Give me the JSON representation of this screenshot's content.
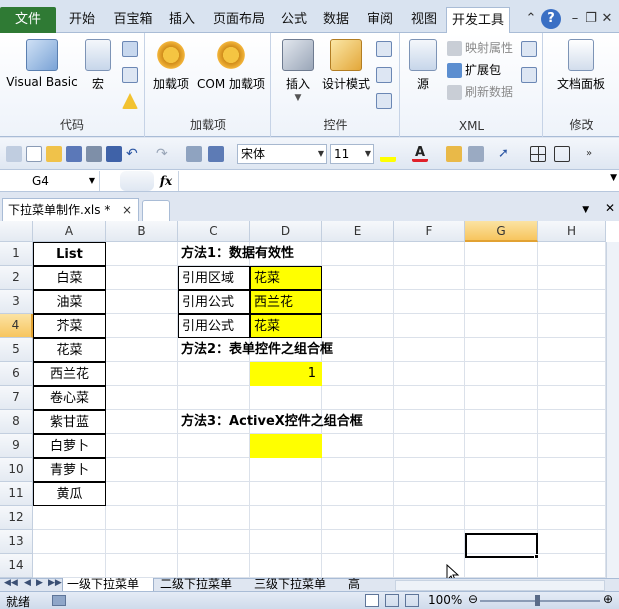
{
  "ribbon_tabs": {
    "file": "文件",
    "items": [
      "开始",
      "百宝箱",
      "插入",
      "页面布局",
      "公式",
      "数据",
      "审阅",
      "视图",
      "开发工具"
    ]
  },
  "window_icons": [
    "minimize-arrow-icon",
    "help-icon",
    "minimize-icon",
    "restore-icon",
    "close-icon"
  ],
  "ribbon": {
    "code": {
      "label": "代码",
      "visual_basic": "Visual Basic",
      "macro": "宏"
    },
    "addins": {
      "label": "加载项",
      "addins": "加载项",
      "com_addins": "COM 加载项"
    },
    "controls": {
      "label": "控件",
      "insert": "插入",
      "design_mode": "设计模式"
    },
    "xml": {
      "label": "XML",
      "source": "源",
      "map_props": "映射属性",
      "expansion": "扩展包",
      "refresh": "刷新数据"
    },
    "modify": {
      "label": "修改",
      "doc_panel": "文档面板"
    }
  },
  "toolbar": {
    "font": "宋体",
    "size": "11"
  },
  "formula": {
    "namebox": "G4",
    "fx": "fx",
    "value": ""
  },
  "workbook": {
    "tab": "下拉菜单制作.xls *",
    "close": "×"
  },
  "columns": [
    "A",
    "B",
    "C",
    "D",
    "E",
    "F",
    "G",
    "H"
  ],
  "rows": [
    "1",
    "2",
    "3",
    "4",
    "5",
    "6",
    "7",
    "8",
    "9",
    "10",
    "11",
    "12",
    "13",
    "14"
  ],
  "cells": {
    "A1": "List",
    "A2": "白菜",
    "A3": "油菜",
    "A4": "芥菜",
    "A5": "花菜",
    "A6": "西兰花",
    "A7": "卷心菜",
    "A8": "紫甘蓝",
    "A9": "白萝卜",
    "A10": "青萝卜",
    "A11": "黄瓜",
    "C1": "方法1：数据有效性",
    "C2": "引用区域",
    "D2": "花菜",
    "C3": "引用公式",
    "D3": "西兰花",
    "C4": "引用公式",
    "D4": "花菜",
    "C5": "方法2：表单控件之组合框",
    "D6": "1",
    "C8": "方法3：ActiveX控件之组合框"
  },
  "selected_cell": "G4",
  "sheets": [
    "一级下拉菜单",
    "二级下拉菜单",
    "三级下拉菜单",
    "高"
  ],
  "status": {
    "ready": "就绪",
    "zoom": "100%"
  },
  "colors": {
    "file_tab": "#2f7a34",
    "highlight": "#ffff00",
    "selection_header": "#f7c55e"
  }
}
